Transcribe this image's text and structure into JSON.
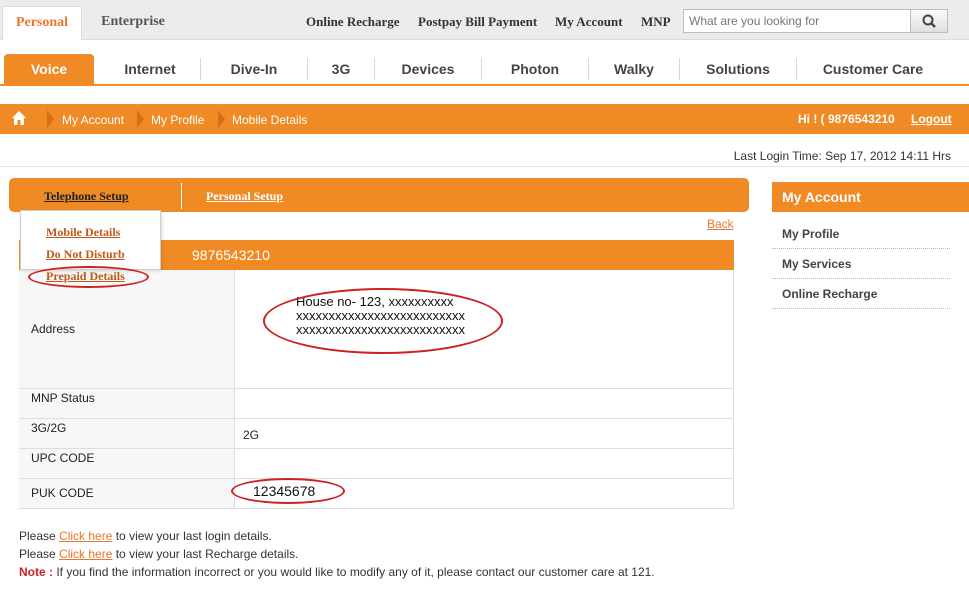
{
  "topbar": {
    "segments": [
      "Personal",
      "Enterprise"
    ],
    "links": [
      "Online Recharge",
      "Postpay Bill Payment",
      "My Account",
      "MNP"
    ],
    "search_placeholder": "What are you looking for"
  },
  "nav": {
    "tabs": [
      "Voice",
      "Internet",
      "Dive-In",
      "3G",
      "Devices",
      "Photon",
      "Walky",
      "Solutions",
      "Customer Care"
    ]
  },
  "breadcrumb": {
    "items": [
      "My Account",
      "My Profile",
      "Mobile Details"
    ],
    "greeting": "Hi ! ( 9876543210",
    "logout": "Logout"
  },
  "last_login": "Last Login Time: Sep 17, 2012 14:11 Hrs",
  "setup": {
    "tabs": [
      "Telephone Setup",
      "Personal Setup"
    ],
    "menu": [
      "Mobile Details",
      "Do Not Disturb",
      "Prepaid Details"
    ],
    "back": "Back"
  },
  "details": {
    "header_label": "er",
    "header_value": "9876543210",
    "rows": [
      {
        "label": "Address",
        "value_lines": [
          "House no- 123, xxxxxxxxxx",
          "xxxxxxxxxxxxxxxxxxxxxxxxxx",
          "xxxxxxxxxxxxxxxxxxxxxxxxxx"
        ]
      },
      {
        "label": "MNP Status",
        "value": ""
      },
      {
        "label": "3G/2G",
        "value": "2G"
      },
      {
        "label": "UPC CODE",
        "value": ""
      },
      {
        "label": "PUK CODE",
        "value": "12345678"
      }
    ]
  },
  "notes": {
    "line1_pre": "Please ",
    "line1_link": "Click here",
    "line1_post": " to view your last login details.",
    "line2_pre": "Please ",
    "line2_link": "Click here",
    "line2_post": " to view your last Recharge details.",
    "note_label": "Note :",
    "note_text": " If you find the information incorrect or you would like to modify any of it, please contact our customer care at 121."
  },
  "sidebar": {
    "title": "My Account",
    "items": [
      "My Profile",
      "My Services",
      "Online Recharge"
    ]
  },
  "colors": {
    "accent": "#f08a24",
    "highlight_oval": "#cc2222"
  }
}
